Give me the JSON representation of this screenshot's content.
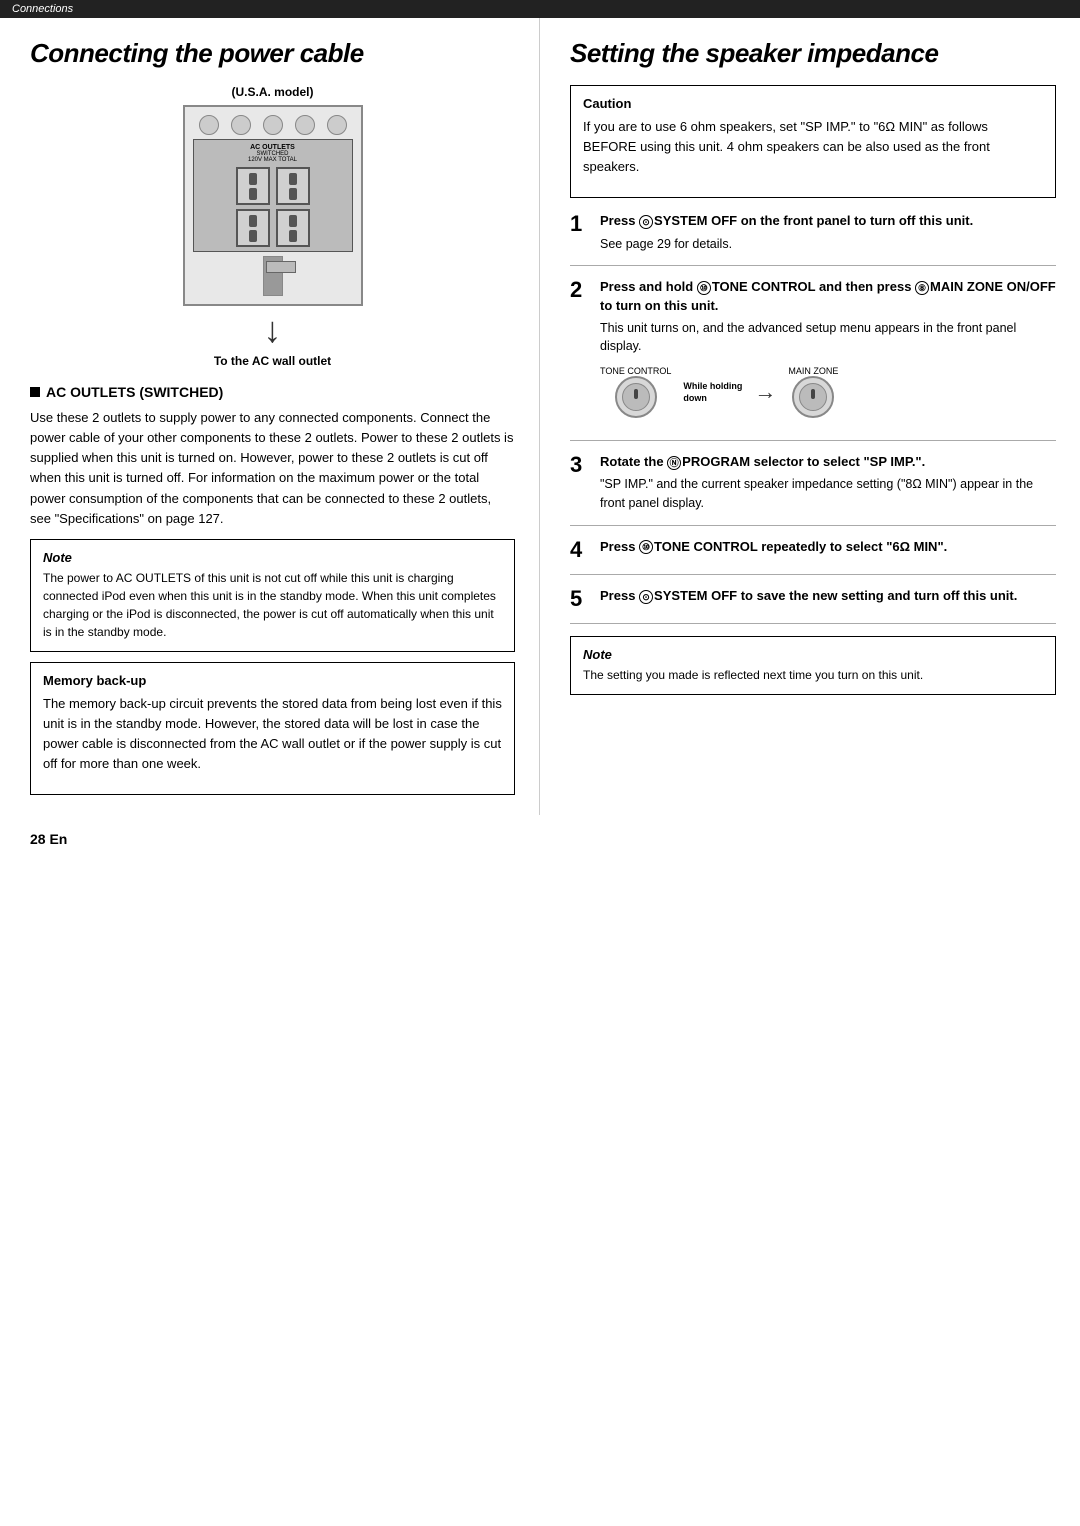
{
  "breadcrumb": "Connections",
  "left": {
    "section_title": "Connecting the power cable",
    "diagram": {
      "label_top": "(U.S.A. model)",
      "label_bottom": "To the AC wall outlet"
    },
    "ac_outlets": {
      "header": "AC OUTLETS (SWITCHED)",
      "body": "Use these 2 outlets to supply power to any connected components. Connect the power cable of your other components to these 2 outlets. Power to these 2 outlets is supplied when this unit is turned on. However, power to these 2 outlets is cut off when this unit is turned off. For information on the maximum power or the total power consumption of the components that can be connected to these 2 outlets, see \"Specifications\" on page 127."
    },
    "note": {
      "title": "Note",
      "text": "The power to AC OUTLETS of this unit is not cut off while this unit is charging connected iPod even when this unit is in the standby mode. When this unit completes charging or the iPod is disconnected, the power is cut off automatically when this unit is in the standby mode."
    },
    "memory_backup": {
      "title": "Memory back-up",
      "text": "The memory back-up circuit prevents the stored data from being lost even if this unit is in the standby mode. However, the stored data will be lost in case the power cable is disconnected from the AC wall outlet or if the power supply is cut off for more than one week."
    }
  },
  "right": {
    "section_title": "Setting the speaker impedance",
    "caution": {
      "title": "Caution",
      "text": "If you are to use 6 ohm speakers, set \"SP IMP.\" to \"6Ω MIN\" as follows BEFORE using this unit. 4 ohm speakers can be also used as the front speakers."
    },
    "steps": [
      {
        "number": "1",
        "heading": "Press ⓪SYSTEM OFF on the front panel to turn off this unit.",
        "body": "See page 29 for details."
      },
      {
        "number": "2",
        "heading": "Press and hold ⑩TONE CONTROL and then press ⑧MAIN ZONE ON/OFF to turn on this unit.",
        "body": "This unit turns on, and the advanced setup menu appears in the front panel display.",
        "has_diagram": true,
        "diagram": {
          "tone_control_label": "TONE CONTROL",
          "while_holding_label": "While holding",
          "down_label": "down",
          "main_zone_label": "MAIN ZONE"
        }
      },
      {
        "number": "3",
        "heading": "Rotate the ⑪PROGRAM selector to select \"SP IMP.\".",
        "body": "\"SP IMP.\" and the current speaker impedance setting (\"8Ω MIN\") appear in the front panel display."
      },
      {
        "number": "4",
        "heading": "Press ⑩TONE CONTROL repeatedly to select \"6Ω MIN\".",
        "body": ""
      },
      {
        "number": "5",
        "heading": "Press ⓪SYSTEM OFF to save the new setting and turn off this unit.",
        "body": ""
      }
    ],
    "note2": {
      "title": "Note",
      "text": "The setting you made is reflected next time you turn on this unit."
    }
  },
  "footer": {
    "page": "28 En"
  }
}
